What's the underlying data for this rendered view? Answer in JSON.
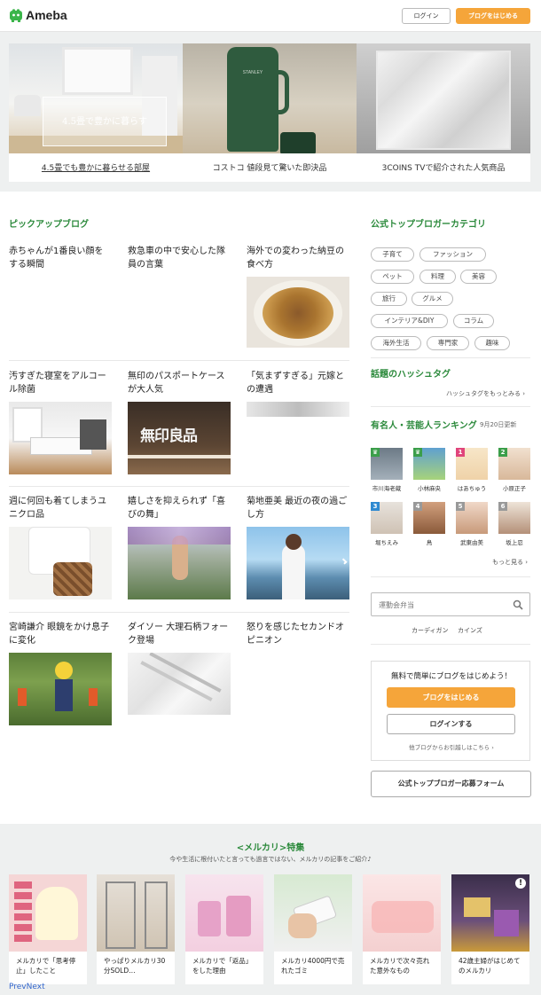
{
  "header": {
    "logo_text": "Ameba",
    "login_label": "ログイン",
    "start_label": "ブログをはじめる"
  },
  "featured": [
    {
      "caption": "4.5畳でも豊かに暮らせる部屋",
      "overlay": "4.5畳で豊かに暮らす",
      "mug_brand": "STANLEY"
    },
    {
      "caption": "コストコ 値段見て驚いた即決品"
    },
    {
      "caption": "3COINS TVで紹介された人気商品"
    }
  ],
  "pickup": {
    "title": "ピックアップブログ",
    "items": [
      {
        "title": "赤ちゃんが1番良い顔をする瞬間"
      },
      {
        "title": "救急車の中で安心した隊員の言葉"
      },
      {
        "title": "海外での変わった納豆の食べ方"
      },
      {
        "title": "汚すぎた寝室をアルコール除菌"
      },
      {
        "title": "無印のパスポートケースが大人気",
        "sign": "無印良品"
      },
      {
        "title": "「気まずすぎる」元嫁との遭遇"
      },
      {
        "title": "週に何回も着てしまうユニクロ品"
      },
      {
        "title": "嬉しさを抑えられず「喜びの舞」"
      },
      {
        "title": "菊地亜美 最近の夜の過ごし方"
      },
      {
        "title": "宮崎謙介 眼鏡をかけ息子に変化"
      },
      {
        "title": "ダイソー 大理石柄フォーク登場"
      },
      {
        "title": "怒りを感じたセカンドオピニオン"
      }
    ]
  },
  "sidebar": {
    "category_title": "公式トップブロガーカテゴリ",
    "tags": [
      "子育て",
      "ファッション",
      "ペット",
      "料理",
      "美容",
      "旅行",
      "グルメ",
      "インテリア&DIY",
      "コラム",
      "海外生活",
      "専門家",
      "趣味"
    ],
    "hashtag_title": "話題のハッシュタグ",
    "hashtag_more": "ハッシュタグをもっとみる",
    "ranking_title": "有名人・芸能人ランキング",
    "ranking_date": "9月20日更新",
    "ranking": [
      {
        "badge": "crown",
        "name": "市川海老蔵"
      },
      {
        "badge": "crown",
        "name": "小林麻央"
      },
      {
        "badge": "1",
        "name": "はあちゅう"
      },
      {
        "badge": "2",
        "name": "小原正子"
      },
      {
        "badge": "3",
        "name": "堀ちえみ"
      },
      {
        "badge": "4",
        "name": "鳥"
      },
      {
        "badge": "5",
        "name": "武東由美"
      },
      {
        "badge": "6",
        "name": "坂上忍"
      }
    ],
    "ranking_more": "もっと見る",
    "search_placeholder": "運動会弁当",
    "search_suggestions": [
      "カーディガン",
      "カインズ"
    ],
    "start_heading": "無料で簡単にブログをはじめよう！",
    "start_button": "ブログをはじめる",
    "login_button": "ログインする",
    "migrate_link": "他ブログからお引越しはこちら",
    "form_button": "公式トップブロガー応募フォーム"
  },
  "mercari": {
    "title": "<メルカリ>特集",
    "subtitle": "今や生活に根付いたと言っても過言ではない、メルカリの記事をご紹介♪",
    "items": [
      {
        "title": "メルカリで「思考停止」したこと"
      },
      {
        "title": "やっぱりメルカリ30分SOLD…"
      },
      {
        "title": "メルカリで「返品」をした理由"
      },
      {
        "title": "メルカリ4000円で売れたゴミ"
      },
      {
        "title": "メルカリで次々売れた意外なもの"
      },
      {
        "title": "42歳主婦がはじめてのメルカリ"
      }
    ],
    "prev": "Prev",
    "next": "Next"
  },
  "colors": {
    "accent_green": "#2c8a3c",
    "orange": "#f5a53a",
    "band": "#eef0f0"
  }
}
